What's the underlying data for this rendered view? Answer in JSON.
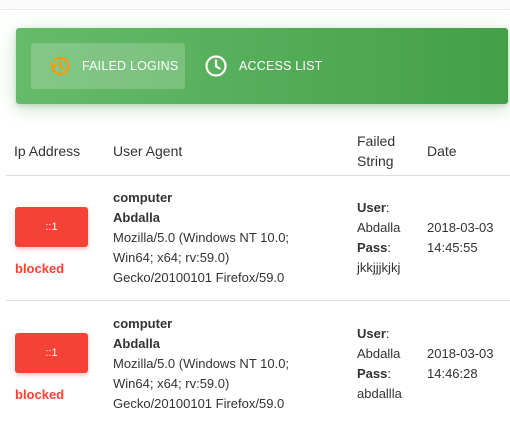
{
  "tabs": [
    {
      "label": "FAILED LOGINS",
      "icon": "history-icon",
      "active": true
    },
    {
      "label": "ACCESS LIST",
      "icon": "clock-icon",
      "active": false
    }
  ],
  "table": {
    "headers": {
      "ip": "Ip Address",
      "user_agent": "User Agent",
      "failed_string_1": "Failed",
      "failed_string_2": "String",
      "date": "Date"
    },
    "rows": [
      {
        "ip": "::1",
        "status": "blocked",
        "ua_host": "computer",
        "ua_user": "Abdalla",
        "ua_lines": [
          "Mozilla/5.0 (Windows NT 10.0;",
          "Win64; x64; rv:59.0)",
          "Gecko/20100101 Firefox/59.0"
        ],
        "user_label": "User",
        "user_value": "Abdalla",
        "pass_label": "Pass",
        "pass_value": "jkkjjjkjkj",
        "date": "2018-03-03",
        "time": "14:45:55"
      },
      {
        "ip": "::1",
        "status": "blocked",
        "ua_host": "computer",
        "ua_user": "Abdalla",
        "ua_lines": [
          "Mozilla/5.0 (Windows NT 10.0;",
          "Win64; x64; rv:59.0)",
          "Gecko/20100101 Firefox/59.0"
        ],
        "user_label": "User",
        "user_value": "Abdalla",
        "pass_label": "Pass",
        "pass_value": "abdallla",
        "date": "2018-03-03",
        "time": "14:46:28"
      }
    ]
  },
  "colors": {
    "accent_green": "#4caf50",
    "danger_red": "#f44336"
  }
}
